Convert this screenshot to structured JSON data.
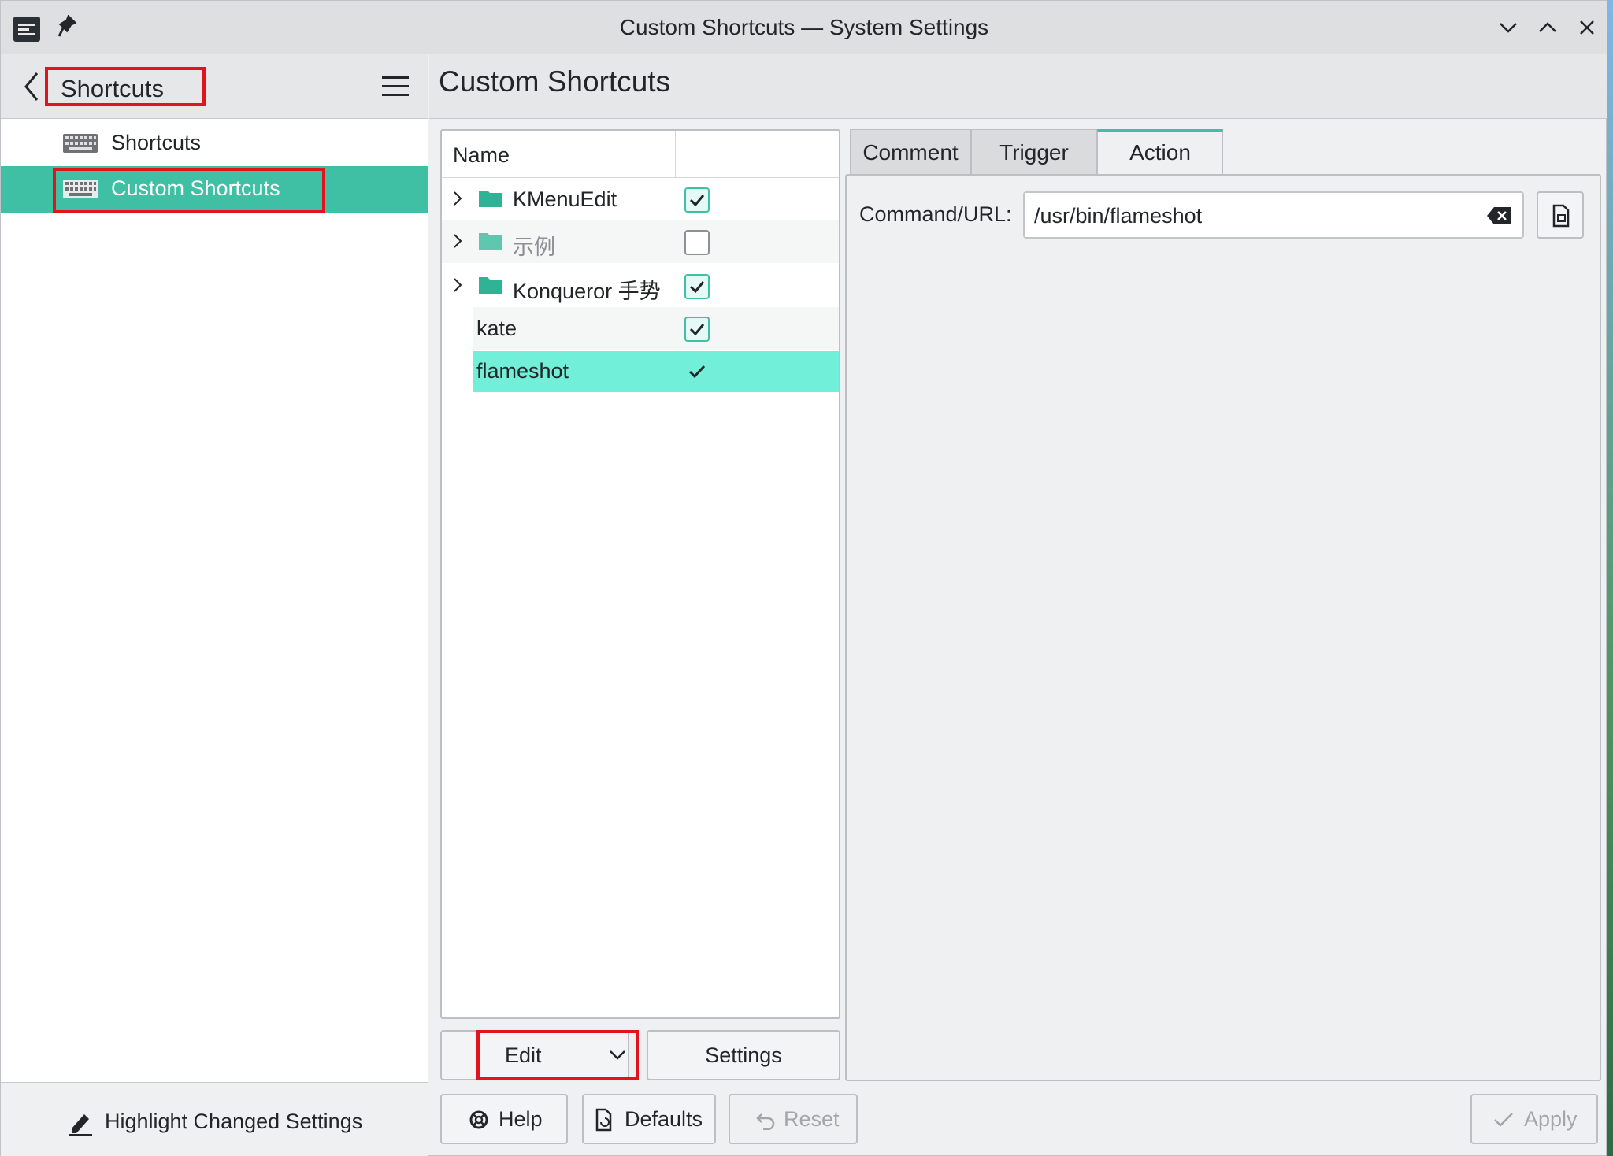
{
  "window": {
    "title": "Custom Shortcuts — System Settings"
  },
  "sidebar": {
    "header_title": "Shortcuts",
    "items": [
      {
        "label": "Shortcuts",
        "icon": "keyboard-icon",
        "selected": false
      },
      {
        "label": "Custom Shortcuts",
        "icon": "keyboard-icon",
        "selected": true
      }
    ],
    "footer_label": "Highlight Changed Settings"
  },
  "main": {
    "title": "Custom Shortcuts"
  },
  "tree": {
    "column_name": "Name",
    "rows": [
      {
        "label": "KMenuEdit",
        "type": "folder",
        "checked": true
      },
      {
        "label": "示例",
        "type": "folder",
        "checked": false
      },
      {
        "label": "Konqueror 手势",
        "type": "folder",
        "checked": true
      },
      {
        "label": "kate",
        "type": "item",
        "checked": true
      },
      {
        "label": "flameshot",
        "type": "item",
        "checked": true,
        "selected": true
      }
    ]
  },
  "tree_buttons": {
    "edit": "Edit",
    "settings": "Settings"
  },
  "tabs": [
    "Comment",
    "Trigger",
    "Action"
  ],
  "active_tab": "Action",
  "action": {
    "command_label": "Command/URL:",
    "command_value": "/usr/bin/flameshot"
  },
  "bottom_buttons": {
    "help": "Help",
    "defaults": "Defaults",
    "reset": "Reset",
    "apply": "Apply"
  },
  "colors": {
    "accent": "#3fbfa3",
    "selection": "#72efd9",
    "highlight_box": "#e0141c"
  }
}
